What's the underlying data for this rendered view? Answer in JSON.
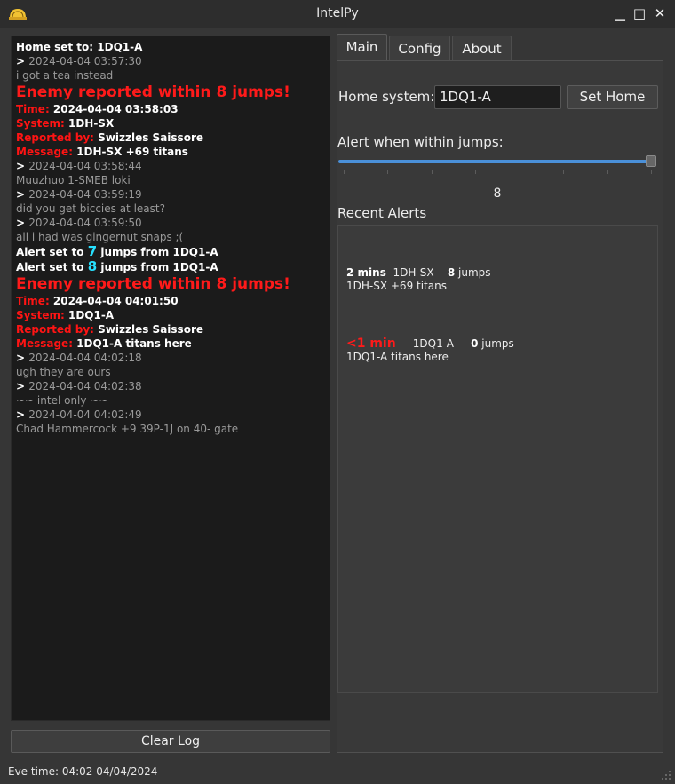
{
  "window": {
    "title": "IntelPy",
    "icon": "dome-icon"
  },
  "log": [
    [
      {
        "t": "Home set to: 1DQ1-A",
        "c": "b"
      }
    ],
    [
      {
        "t": "> ",
        "c": "b"
      },
      {
        "t": "2024-04-04 03:57:30",
        "c": "grey"
      }
    ],
    [
      {
        "t": "i got a tea instead",
        "c": "grey"
      }
    ],
    [
      {
        "t": "Enemy reported within 8 jumps!",
        "c": "big-red"
      }
    ],
    [
      {
        "t": "Time: ",
        "c": "red"
      },
      {
        "t": "2024-04-04 03:58:03",
        "c": "b"
      }
    ],
    [
      {
        "t": "System: ",
        "c": "red"
      },
      {
        "t": "1DH-SX",
        "c": "b"
      }
    ],
    [
      {
        "t": "Reported by: ",
        "c": "red"
      },
      {
        "t": "Swizzles Saissore",
        "c": "b"
      }
    ],
    [
      {
        "t": "Message: ",
        "c": "red"
      },
      {
        "t": "1DH-SX +69 titans",
        "c": "b"
      }
    ],
    [
      {
        "t": "> ",
        "c": "b"
      },
      {
        "t": "2024-04-04 03:58:44",
        "c": "grey"
      }
    ],
    [
      {
        "t": "Muuzhuo 1-SMEB loki",
        "c": "grey"
      }
    ],
    [
      {
        "t": "> ",
        "c": "b"
      },
      {
        "t": "2024-04-04 03:59:19",
        "c": "grey"
      }
    ],
    [
      {
        "t": "did you get biccies at least?",
        "c": "grey"
      }
    ],
    [
      {
        "t": "> ",
        "c": "b"
      },
      {
        "t": "2024-04-04 03:59:50",
        "c": "grey"
      }
    ],
    [
      {
        "t": "all i had was gingernut snaps ;(",
        "c": "grey"
      }
    ],
    [
      {
        "t": "Alert set to ",
        "c": "b"
      },
      {
        "t": "7",
        "c": "cyan"
      },
      {
        "t": " jumps from 1DQ1-A",
        "c": "b"
      }
    ],
    [
      {
        "t": "Alert set to ",
        "c": "b"
      },
      {
        "t": "8",
        "c": "cyan"
      },
      {
        "t": " jumps from 1DQ1-A",
        "c": "b"
      }
    ],
    [
      {
        "t": "Enemy reported within 8 jumps!",
        "c": "big-red"
      }
    ],
    [
      {
        "t": "Time: ",
        "c": "red"
      },
      {
        "t": "2024-04-04 04:01:50",
        "c": "b"
      }
    ],
    [
      {
        "t": "System: ",
        "c": "red"
      },
      {
        "t": "1DQ1-A",
        "c": "b"
      }
    ],
    [
      {
        "t": "Reported by: ",
        "c": "red"
      },
      {
        "t": "Swizzles Saissore",
        "c": "b"
      }
    ],
    [
      {
        "t": "Message: ",
        "c": "red"
      },
      {
        "t": "1DQ1-A titans here",
        "c": "b"
      }
    ],
    [
      {
        "t": "> ",
        "c": "b"
      },
      {
        "t": "2024-04-04 04:02:18",
        "c": "grey"
      }
    ],
    [
      {
        "t": "ugh they are ours",
        "c": "grey"
      }
    ],
    [
      {
        "t": "> ",
        "c": "b"
      },
      {
        "t": "2024-04-04 04:02:38",
        "c": "grey"
      }
    ],
    [
      {
        "t": "~~ intel only ~~",
        "c": "grey"
      }
    ],
    [
      {
        "t": "> ",
        "c": "b"
      },
      {
        "t": "2024-04-04 04:02:49",
        "c": "grey"
      }
    ],
    [
      {
        "t": "Chad Hammercock +9 39P-1J on 40- gate",
        "c": "grey"
      }
    ]
  ],
  "clear_log_label": "Clear Log",
  "status": "Eve time: 04:02 04/04/2024",
  "tabs": [
    {
      "label": "Main",
      "active": true
    },
    {
      "label": "Config"
    },
    {
      "label": "About"
    }
  ],
  "main": {
    "home_label": "Home system:",
    "home_value": "1DQ1-A",
    "set_home_label": "Set Home",
    "alert_label": "Alert when within jumps:",
    "slider": {
      "value": 8,
      "max": 8
    },
    "slider_value_text": "8",
    "recent_label": "Recent Alerts",
    "alerts": [
      {
        "when": "2 mins",
        "system": "1DH-SX",
        "jumps": "8",
        "jumps_word": " jumps",
        "message": "1DH-SX +69 titans",
        "urgent": false
      },
      {
        "when": "<1 min",
        "system": "1DQ1-A",
        "jumps": "0",
        "jumps_word": " jumps",
        "message": "1DQ1-A titans here",
        "urgent": true
      }
    ]
  },
  "colors": {
    "accent": "#4a90d9",
    "alert_red": "#ff1a1a",
    "highlight_cyan": "#27e0ff"
  }
}
